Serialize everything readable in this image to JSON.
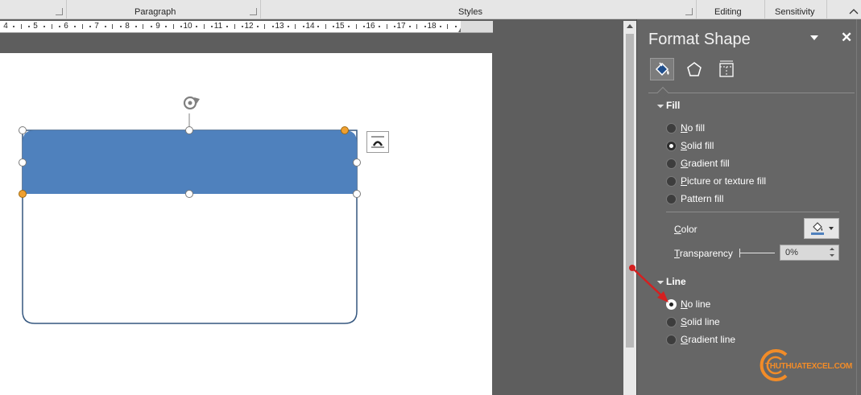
{
  "ribbon": {
    "groups": [
      "Paragraph",
      "Styles",
      "Editing",
      "Sensitivity"
    ]
  },
  "ruler": {
    "numbers": [
      "4",
      "5",
      "6",
      "7",
      "8",
      "9",
      "10",
      "11",
      "12",
      "13",
      "14",
      "15",
      "16",
      "17",
      "18"
    ]
  },
  "pane": {
    "title": "Format Shape",
    "tabs": [
      "fill-line-icon",
      "effects-pentagon-icon",
      "size-properties-icon"
    ],
    "fill": {
      "heading": "Fill",
      "options": [
        {
          "label": "No fill",
          "selected": false
        },
        {
          "label": "Solid fill",
          "selected": true
        },
        {
          "label": "Gradient fill",
          "selected": false
        },
        {
          "label": "Picture or texture fill",
          "selected": false
        },
        {
          "label": "Pattern fill",
          "selected": false
        }
      ],
      "color_label": "Color",
      "transparency_label": "Transparency",
      "transparency_value": "0%",
      "color": "#4f81bd"
    },
    "line": {
      "heading": "Line",
      "options": [
        {
          "label": "No line",
          "selected": true
        },
        {
          "label": "Solid line",
          "selected": false
        },
        {
          "label": "Gradient line",
          "selected": false
        }
      ]
    }
  },
  "shape": {
    "fill_color": "#4f81bd",
    "outline_color": "#2f4f75"
  },
  "watermark": {
    "text": "THUTHUATEXCEL.COM"
  }
}
